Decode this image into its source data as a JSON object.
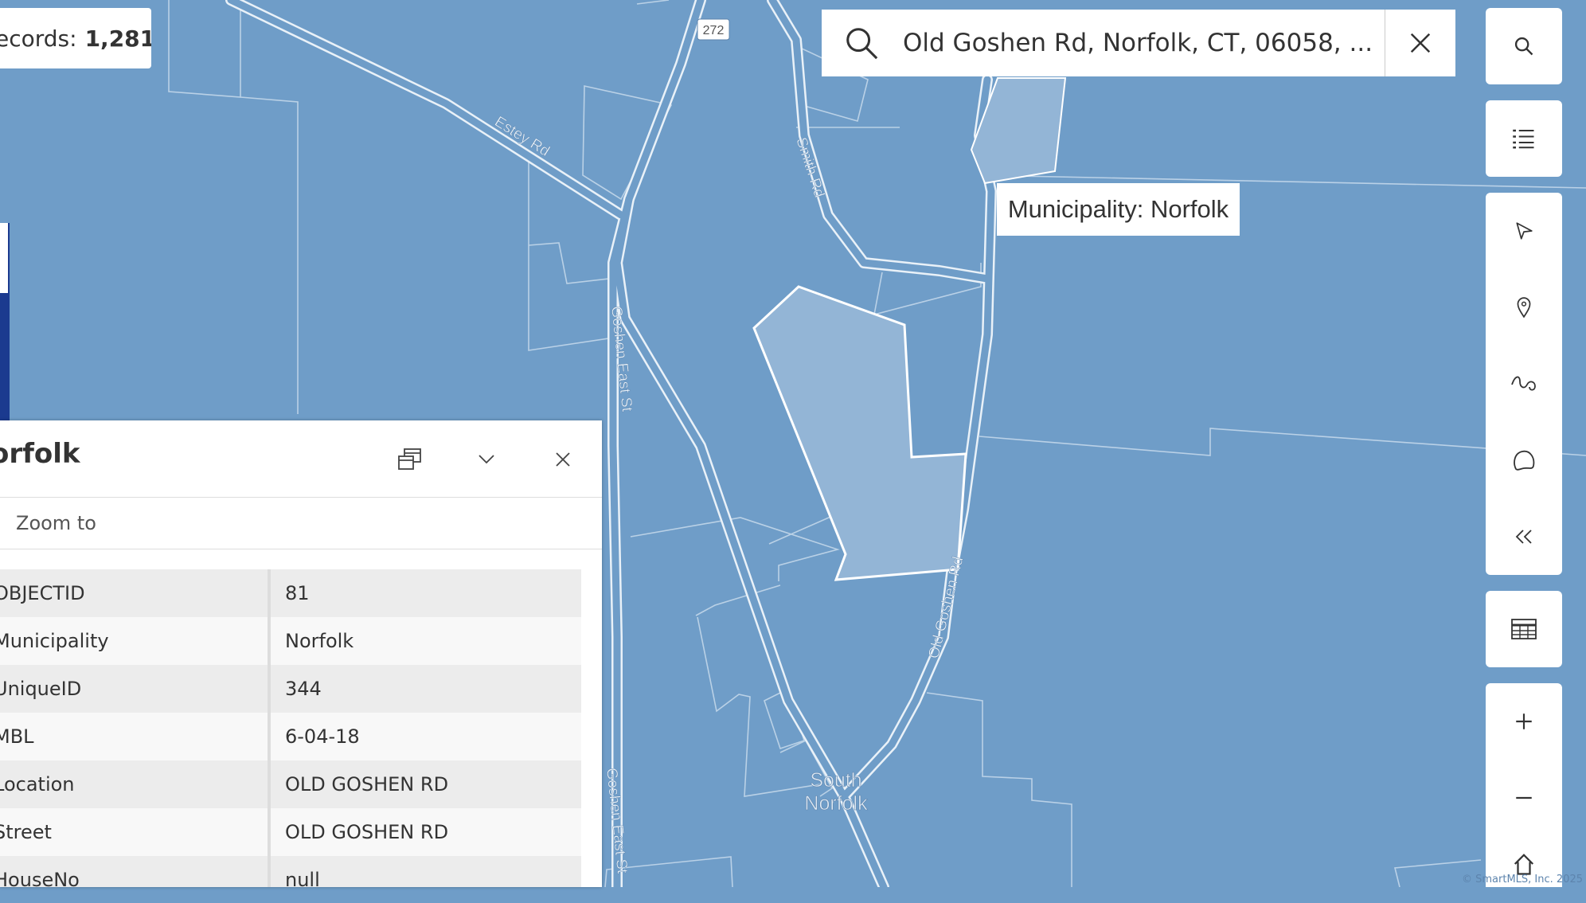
{
  "records": {
    "label": "ecords:",
    "count": "1,281"
  },
  "search": {
    "value": "Old Goshen Rd, Norfolk, CT, 06058, ..."
  },
  "tooltip": "Municipality: Norfolk",
  "map_labels": {
    "route": "272",
    "estey": "Estey Rd",
    "smith": "Smith Rd",
    "goshen_east_1": "Goshen East St",
    "goshen_east_2": "Goshen East St",
    "old_goshen": "Old Goshen Rd",
    "south": "South",
    "norfolk": "Norfolk"
  },
  "popup": {
    "title": "orfolk",
    "zoom_label": "Zoom to",
    "rows": [
      {
        "key": "OBJECTID",
        "value": "81"
      },
      {
        "key": "Municipality",
        "value": "Norfolk"
      },
      {
        "key": "UniqueID",
        "value": "344"
      },
      {
        "key": "MBL",
        "value": "6-04-18"
      },
      {
        "key": "Location",
        "value": "OLD GOSHEN RD"
      },
      {
        "key": "Street",
        "value": "OLD GOSHEN RD"
      },
      {
        "key": "HouseNo",
        "value": "null"
      }
    ]
  },
  "copyright": "© SmartMLS, Inc. 2025",
  "colors": {
    "map_bg": "#6f9dc8",
    "parcel_fill": "#93b5d6",
    "accent_strip": "#1b3a8f"
  }
}
